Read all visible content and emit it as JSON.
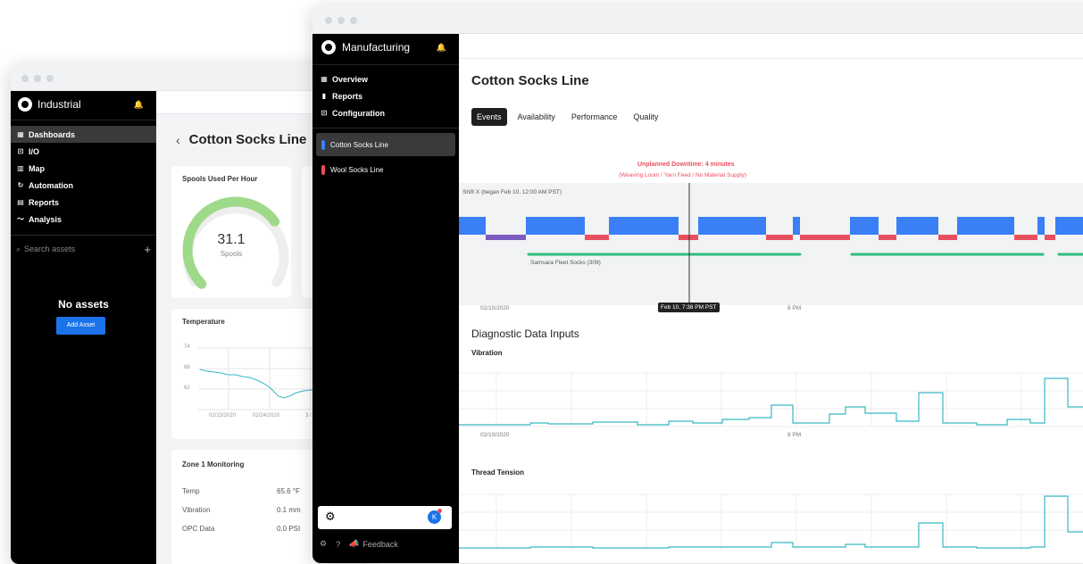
{
  "back_window": {
    "app_name": "Industrial",
    "nav": [
      {
        "label": "Dashboards",
        "icon": "grid-icon"
      },
      {
        "label": "I/O",
        "icon": "io-icon"
      },
      {
        "label": "Map",
        "icon": "map-icon"
      },
      {
        "label": "Automation",
        "icon": "automation-icon"
      },
      {
        "label": "Reports",
        "icon": "reports-icon"
      },
      {
        "label": "Analysis",
        "icon": "analysis-icon"
      }
    ],
    "search_placeholder": "Search assets",
    "empty_title": "No assets",
    "add_asset_label": "Add Asset",
    "back_arrow": "‹",
    "page_title": "Cotton Socks Line",
    "spools_card": {
      "title": "Spools Used Per Hour",
      "value": "31.1",
      "unit": "Spools",
      "fraction": 0.7
    },
    "temperature_card": {
      "title": "Temperature",
      "y_ticks": [
        "74",
        "68",
        "62"
      ],
      "x_ticks": [
        "02/23/2020",
        "02/24/2020",
        "3 /"
      ]
    },
    "zone_card": {
      "title": "Zone 1 Monitoring",
      "rows": [
        {
          "label": "Temp",
          "value": "65.6 °F"
        },
        {
          "label": "Vibration",
          "value": "0.1 mm"
        },
        {
          "label": "OPC Data",
          "value": "0.0 PSI"
        }
      ]
    }
  },
  "front_window": {
    "app_name": "Manufacturing",
    "nav": [
      {
        "label": "Overview",
        "icon": "grid-icon"
      },
      {
        "label": "Reports",
        "icon": "bar-chart-icon"
      },
      {
        "label": "Configuration",
        "icon": "config-icon"
      }
    ],
    "lines": [
      {
        "label": "Cotton Socks Line",
        "color": "#3b82f6"
      },
      {
        "label": "Wool Socks Line",
        "color": "#ef4a5c"
      }
    ],
    "user_initial": "K",
    "feedback_label": "Feedback",
    "page_title": "Cotton Socks Line",
    "tabs": [
      "Events",
      "Availability",
      "Performance",
      "Quality"
    ],
    "active_tab": "Events",
    "events": {
      "annotation_title": "Unplanned Downtime: 4 minutes",
      "annotation_sub": "(Weaving Loom / Yarn Feed / No Material Supply)",
      "shift_label": "Shift X (began Feb 10, 12:00 AM PST)",
      "fleet_label": "Samsara Fleet Socks (309)",
      "x_ticks": [
        "02/10/2020",
        "8 PM"
      ],
      "cursor_label": "Feb 10, 7:38 PM PST"
    },
    "diagnostic_title": "Diagnostic Data Inputs",
    "vibration_title": "Vibration",
    "vibration_x_ticks": [
      "02/10/2020",
      "8 PM"
    ],
    "thread_title": "Thread Tension"
  },
  "colors": {
    "running": "#3a7ff6",
    "idle": "#7b5dbf",
    "downtime": "#e8505f",
    "fleet": "#2fbe7c",
    "line": "#38b7c4",
    "gauge": "#9fd98a",
    "accent": "#1a73e8"
  }
}
